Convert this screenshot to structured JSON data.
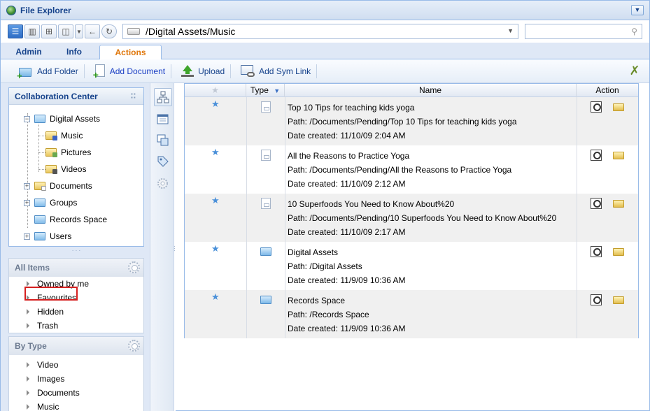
{
  "window": {
    "title": "File Explorer"
  },
  "pathbar": {
    "path": "/Digital Assets/Music",
    "search_value": ""
  },
  "tabs": [
    {
      "label": "Admin",
      "active": false
    },
    {
      "label": "Info",
      "active": false
    },
    {
      "label": "Actions",
      "active": true
    }
  ],
  "toolbar": {
    "add_folder": "Add Folder",
    "add_document": "Add Document",
    "upload": "Upload",
    "add_sym_link": "Add Sym Link"
  },
  "collab": {
    "title": "Collaboration Center",
    "tree": [
      {
        "label": "Digital Assets",
        "level": 0,
        "expanded": true,
        "icon": "folder-open-icon"
      },
      {
        "label": "Music",
        "level": 1,
        "icon": "music-folder-icon"
      },
      {
        "label": "Pictures",
        "level": 1,
        "icon": "pictures-folder-icon"
      },
      {
        "label": "Videos",
        "level": 1,
        "icon": "videos-folder-icon"
      },
      {
        "label": "Documents",
        "level": 0,
        "expanded": false,
        "icon": "documents-folder-icon"
      },
      {
        "label": "Groups",
        "level": 0,
        "expanded": false,
        "icon": "folder-icon"
      },
      {
        "label": "Records Space",
        "level": 0,
        "expanded": null,
        "icon": "folder-icon"
      },
      {
        "label": "Users",
        "level": 0,
        "expanded": false,
        "icon": "folder-icon"
      }
    ]
  },
  "all_items": {
    "title": "All Items",
    "items": [
      "Owned by me",
      "Favourites",
      "Hidden",
      "Trash"
    ],
    "highlighted": "Favourites"
  },
  "by_type": {
    "title": "By Type",
    "items": [
      "Video",
      "Images",
      "Documents",
      "Music"
    ]
  },
  "grid": {
    "columns": {
      "type": "Type",
      "name": "Name",
      "action": "Action"
    },
    "sort": "Type descending",
    "rows": [
      {
        "type": "document",
        "name": "Top 10 Tips for teaching kids yoga",
        "path": "Path: /Documents/Pending/Top 10 Tips for teaching kids yoga",
        "date": "Date created: 11/10/09 2:04 AM"
      },
      {
        "type": "document",
        "name": "All the Reasons to Practice Yoga",
        "path": "Path: /Documents/Pending/All the Reasons to Practice Yoga",
        "date": "Date created: 11/10/09 2:12 AM"
      },
      {
        "type": "document",
        "name": "10 Superfoods You Need to Know About%20",
        "path": "Path: /Documents/Pending/10 Superfoods You Need to Know About%20",
        "date": "Date created: 11/10/09 2:17 AM"
      },
      {
        "type": "folder",
        "name": "Digital Assets",
        "path": "Path: /Digital Assets",
        "date": "Date created: 11/9/09 10:36 AM"
      },
      {
        "type": "folder",
        "name": "Records Space",
        "path": "Path: /Records Space",
        "date": "Date created: 11/9/09 10:36 AM"
      }
    ]
  },
  "colors": {
    "accent": "#15428b",
    "active_tab": "#e0780d",
    "highlight": "#d62020",
    "star": "#4a90d9"
  }
}
